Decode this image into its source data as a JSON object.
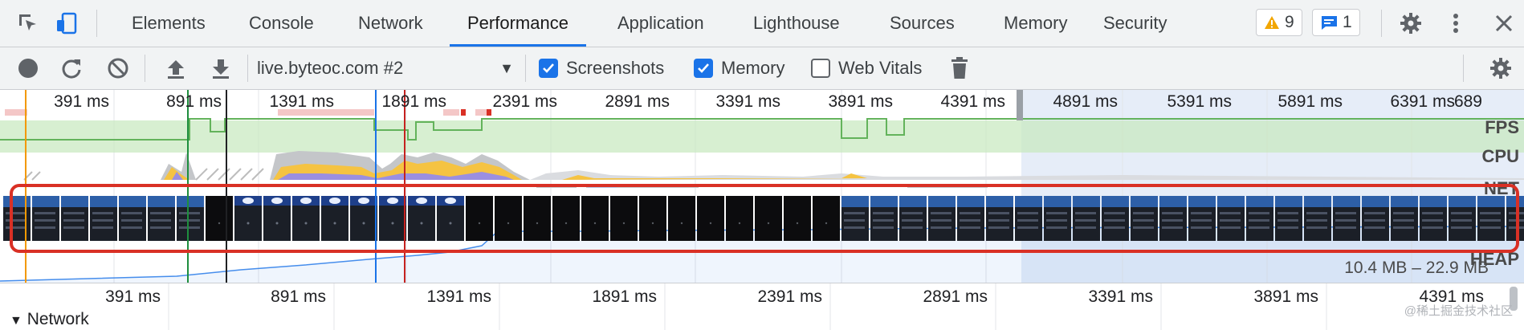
{
  "tabs": [
    "Elements",
    "Console",
    "Network",
    "Performance",
    "Application",
    "Lighthouse",
    "Sources",
    "Memory",
    "Security"
  ],
  "active_tab": "Performance",
  "badges": {
    "warnings": "9",
    "messages": "1"
  },
  "toolbar": {
    "recording": "live.byteoc.com #2",
    "screenshots_label": "Screenshots",
    "memory_label": "Memory",
    "web_vitals_label": "Web Vitals",
    "screenshots_checked": true,
    "memory_checked": true,
    "web_vitals_checked": false
  },
  "overview": {
    "ticks": [
      "391 ms",
      "891 ms",
      "1391 ms",
      "1891 ms",
      "2391 ms",
      "2891 ms",
      "3391 ms",
      "3891 ms",
      "4391 ms",
      "4891 ms",
      "5391 ms",
      "5891 ms",
      "6391 ms",
      "689"
    ],
    "tracks": {
      "fps": "FPS",
      "cpu": "CPU",
      "net": "NET",
      "heap": "HEAP"
    },
    "heap_range": "10.4 MB – 22.9 MB"
  },
  "timeline": {
    "ticks": [
      "391 ms",
      "891 ms",
      "1391 ms",
      "1891 ms",
      "2391 ms",
      "2891 ms",
      "3391 ms",
      "3891 ms",
      "4391 ms"
    ],
    "network_label": "Network"
  },
  "watermark": "@稀土掘金技术社区",
  "colors": {
    "accent": "#1a73e8",
    "fps": "#c6e8bd",
    "cpu_script": "#f5c342",
    "cpu_render": "#9b8fe0",
    "heap": "#1a73e8",
    "highlight": "#d93025"
  }
}
